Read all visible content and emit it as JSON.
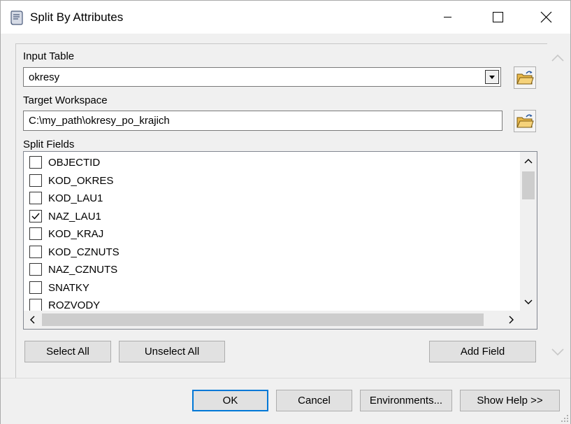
{
  "window": {
    "title": "Split By Attributes"
  },
  "input_table": {
    "label": "Input Table",
    "value": "okresy"
  },
  "target_workspace": {
    "label": "Target Workspace",
    "value": "C:\\my_path\\okresy_po_krajich"
  },
  "split_fields": {
    "label": "Split Fields",
    "items": [
      {
        "label": "OBJECTID",
        "checked": false
      },
      {
        "label": "KOD_OKRES",
        "checked": false
      },
      {
        "label": "KOD_LAU1",
        "checked": false
      },
      {
        "label": "NAZ_LAU1",
        "checked": true
      },
      {
        "label": "KOD_KRAJ",
        "checked": false
      },
      {
        "label": "KOD_CZNUTS",
        "checked": false
      },
      {
        "label": "NAZ_CZNUTS",
        "checked": false
      },
      {
        "label": "SNATKY",
        "checked": false
      },
      {
        "label": "ROZVODY",
        "checked": false
      }
    ]
  },
  "list_buttons": {
    "select_all": "Select All",
    "unselect_all": "Unselect All",
    "add_field": "Add Field"
  },
  "footer": {
    "ok": "OK",
    "cancel": "Cancel",
    "environments": "Environments...",
    "show_help": "Show Help >>"
  },
  "icons": {
    "app": "script-tool-icon",
    "minimize": "minimize-icon",
    "maximize": "maximize-icon",
    "close": "close-icon",
    "folder": "open-folder-icon"
  },
  "colors": {
    "accent": "#0078d7",
    "folder": "#e8b84a"
  }
}
